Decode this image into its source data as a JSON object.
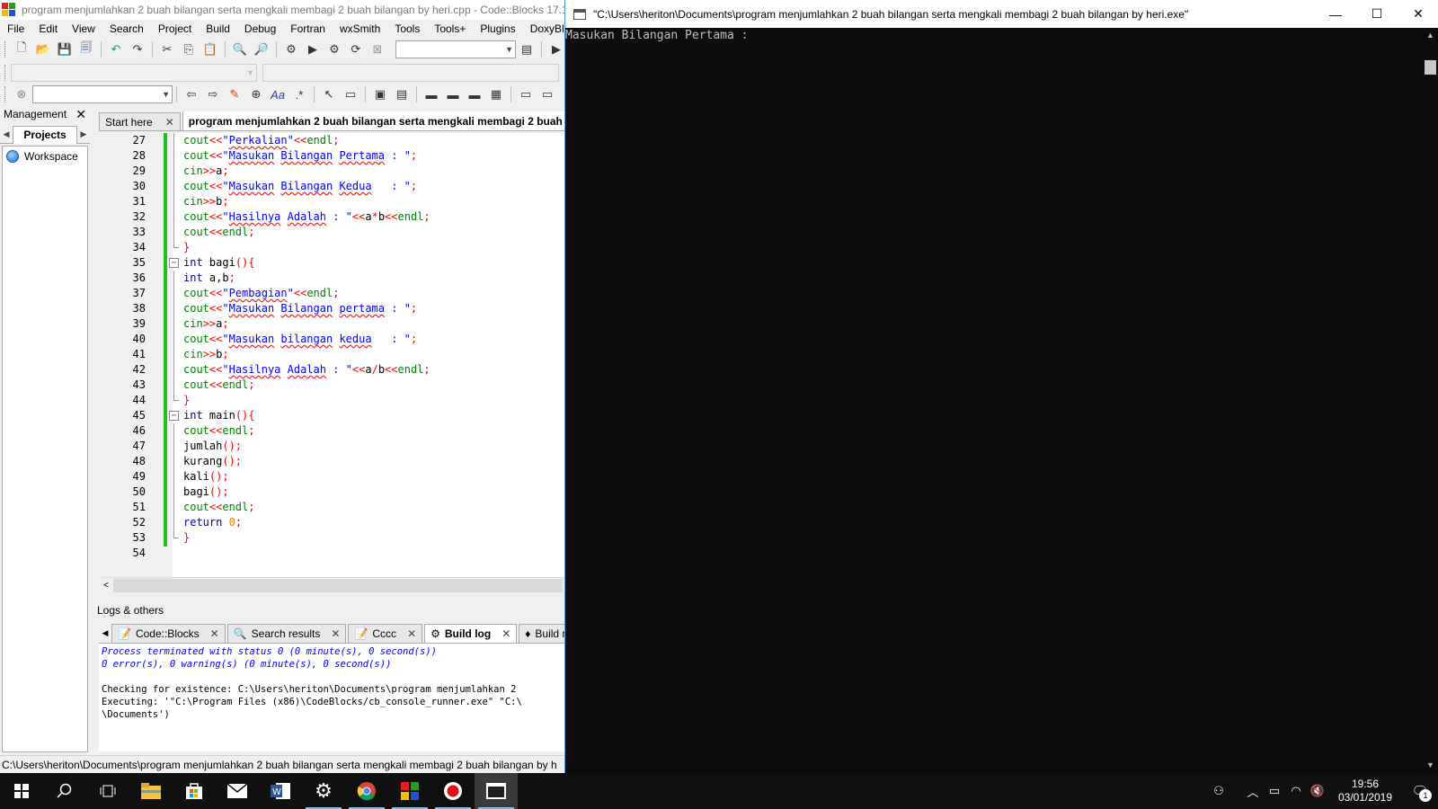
{
  "ide": {
    "title": "program menjumlahkan 2 buah bilangan serta mengkali membagi 2 buah bilangan by heri.cpp - Code::Blocks 17.1",
    "menu": [
      "File",
      "Edit",
      "View",
      "Search",
      "Project",
      "Build",
      "Debug",
      "Fortran",
      "wxSmith",
      "Tools",
      "Tools+",
      "Plugins",
      "DoxyBlocks"
    ],
    "management": {
      "title": "Management",
      "tab": "Projects",
      "workspace": "Workspace"
    },
    "editor_tabs": [
      {
        "label": "Start here",
        "active": false
      },
      {
        "label": "program menjumlahkan 2 buah bilangan serta mengkali membagi 2 buah",
        "active": true
      }
    ],
    "code_lines": [
      {
        "n": "27",
        "segs": [
          [
            "io",
            "cout"
          ],
          [
            "op",
            "<<"
          ],
          [
            "str",
            "\""
          ],
          [
            "str sq",
            "Perkalian"
          ],
          [
            "str",
            "\""
          ],
          [
            "op",
            "<<"
          ],
          [
            "io",
            "endl"
          ],
          [
            "op",
            ";"
          ]
        ]
      },
      {
        "n": "28",
        "segs": [
          [
            "io",
            "cout"
          ],
          [
            "op",
            "<<"
          ],
          [
            "str",
            "\""
          ],
          [
            "str sq",
            "Masukan"
          ],
          [
            "str",
            " "
          ],
          [
            "str sq",
            "Bilangan"
          ],
          [
            "str",
            " "
          ],
          [
            "str sq",
            "Pertama"
          ],
          [
            "str",
            " : \""
          ],
          [
            "op",
            ";"
          ]
        ]
      },
      {
        "n": "29",
        "segs": [
          [
            "io",
            "cin"
          ],
          [
            "op",
            ">>"
          ],
          [
            "id",
            "a"
          ],
          [
            "op",
            ";"
          ]
        ]
      },
      {
        "n": "30",
        "segs": [
          [
            "io",
            "cout"
          ],
          [
            "op",
            "<<"
          ],
          [
            "str",
            "\""
          ],
          [
            "str sq",
            "Masukan"
          ],
          [
            "str",
            " "
          ],
          [
            "str sq",
            "Bilangan"
          ],
          [
            "str",
            " "
          ],
          [
            "str sq",
            "Kedua"
          ],
          [
            "str",
            "   : \""
          ],
          [
            "op",
            ";"
          ]
        ]
      },
      {
        "n": "31",
        "segs": [
          [
            "io",
            "cin"
          ],
          [
            "op",
            ">>"
          ],
          [
            "id",
            "b"
          ],
          [
            "op",
            ";"
          ]
        ]
      },
      {
        "n": "32",
        "segs": [
          [
            "io",
            "cout"
          ],
          [
            "op",
            "<<"
          ],
          [
            "str",
            "\""
          ],
          [
            "str sq",
            "Hasilnya"
          ],
          [
            "str",
            " "
          ],
          [
            "str sq",
            "Adalah"
          ],
          [
            "str",
            " : \""
          ],
          [
            "op",
            "<<"
          ],
          [
            "id",
            "a"
          ],
          [
            "op",
            "*"
          ],
          [
            "id",
            "b"
          ],
          [
            "op",
            "<<"
          ],
          [
            "io",
            "endl"
          ],
          [
            "op",
            ";"
          ]
        ]
      },
      {
        "n": "33",
        "segs": [
          [
            "io",
            "cout"
          ],
          [
            "op",
            "<<"
          ],
          [
            "io",
            "endl"
          ],
          [
            "op",
            ";"
          ]
        ]
      },
      {
        "n": "34",
        "segs": [
          [
            "op",
            "}"
          ]
        ]
      },
      {
        "n": "35",
        "segs": [
          [
            "kw",
            "int"
          ],
          [
            "id",
            " bagi"
          ],
          [
            "op",
            "(){"
          ]
        ]
      },
      {
        "n": "36",
        "segs": [
          [
            "kw",
            "int"
          ],
          [
            "id",
            " a,b"
          ],
          [
            "op",
            ";"
          ]
        ]
      },
      {
        "n": "37",
        "segs": [
          [
            "io",
            "cout"
          ],
          [
            "op",
            "<<"
          ],
          [
            "str",
            "\""
          ],
          [
            "str sq",
            "Pembagian"
          ],
          [
            "str",
            "\""
          ],
          [
            "op",
            "<<"
          ],
          [
            "io",
            "endl"
          ],
          [
            "op",
            ";"
          ]
        ]
      },
      {
        "n": "38",
        "segs": [
          [
            "io",
            "cout"
          ],
          [
            "op",
            "<<"
          ],
          [
            "str",
            "\""
          ],
          [
            "str sq",
            "Masukan"
          ],
          [
            "str",
            " "
          ],
          [
            "str sq",
            "Bilangan"
          ],
          [
            "str",
            " "
          ],
          [
            "str sq",
            "pertama"
          ],
          [
            "str",
            " : \""
          ],
          [
            "op",
            ";"
          ]
        ]
      },
      {
        "n": "39",
        "segs": [
          [
            "io",
            "cin"
          ],
          [
            "op",
            ">>"
          ],
          [
            "id",
            "a"
          ],
          [
            "op",
            ";"
          ]
        ]
      },
      {
        "n": "40",
        "segs": [
          [
            "io",
            "cout"
          ],
          [
            "op",
            "<<"
          ],
          [
            "str",
            "\""
          ],
          [
            "str sq",
            "Masukan"
          ],
          [
            "str",
            " "
          ],
          [
            "str sq",
            "bilangan"
          ],
          [
            "str",
            " "
          ],
          [
            "str sq",
            "kedua"
          ],
          [
            "str",
            "   : \""
          ],
          [
            "op",
            ";"
          ]
        ]
      },
      {
        "n": "41",
        "segs": [
          [
            "io",
            "cin"
          ],
          [
            "op",
            ">>"
          ],
          [
            "id",
            "b"
          ],
          [
            "op",
            ";"
          ]
        ]
      },
      {
        "n": "42",
        "segs": [
          [
            "io",
            "cout"
          ],
          [
            "op",
            "<<"
          ],
          [
            "str",
            "\""
          ],
          [
            "str sq",
            "Hasilnya"
          ],
          [
            "str",
            " "
          ],
          [
            "str sq",
            "Adalah"
          ],
          [
            "str",
            " : \""
          ],
          [
            "op",
            "<<"
          ],
          [
            "id",
            "a"
          ],
          [
            "op",
            "/"
          ],
          [
            "id",
            "b"
          ],
          [
            "op",
            "<<"
          ],
          [
            "io",
            "endl"
          ],
          [
            "op",
            ";"
          ]
        ]
      },
      {
        "n": "43",
        "segs": [
          [
            "io",
            "cout"
          ],
          [
            "op",
            "<<"
          ],
          [
            "io",
            "endl"
          ],
          [
            "op",
            ";"
          ]
        ]
      },
      {
        "n": "44",
        "segs": [
          [
            "op",
            "}"
          ]
        ]
      },
      {
        "n": "45",
        "segs": [
          [
            "kw",
            "int"
          ],
          [
            "id",
            " main"
          ],
          [
            "op",
            "(){"
          ]
        ]
      },
      {
        "n": "46",
        "segs": [
          [
            "io",
            "cout"
          ],
          [
            "op",
            "<<"
          ],
          [
            "io",
            "endl"
          ],
          [
            "op",
            ";"
          ]
        ]
      },
      {
        "n": "47",
        "segs": [
          [
            "id",
            "jumlah"
          ],
          [
            "op",
            "();"
          ]
        ]
      },
      {
        "n": "48",
        "segs": [
          [
            "id",
            "kurang"
          ],
          [
            "op",
            "();"
          ]
        ]
      },
      {
        "n": "49",
        "segs": [
          [
            "id",
            "kali"
          ],
          [
            "op",
            "();"
          ]
        ]
      },
      {
        "n": "50",
        "segs": [
          [
            "id",
            "bagi"
          ],
          [
            "op",
            "();"
          ]
        ]
      },
      {
        "n": "51",
        "segs": [
          [
            "io",
            "cout"
          ],
          [
            "op",
            "<<"
          ],
          [
            "io",
            "endl"
          ],
          [
            "op",
            ";"
          ]
        ]
      },
      {
        "n": "52",
        "segs": [
          [
            "kw",
            "return"
          ],
          [
            "id",
            " "
          ],
          [
            "num",
            "0"
          ],
          [
            "op",
            ";"
          ]
        ]
      },
      {
        "n": "53",
        "segs": [
          [
            "op",
            "}"
          ]
        ]
      },
      {
        "n": "54",
        "segs": []
      }
    ],
    "logs": {
      "title": "Logs & others",
      "tabs": [
        {
          "label": "Code::Blocks",
          "icon": "📝",
          "active": false,
          "close": true
        },
        {
          "label": "Search results",
          "icon": "🔍",
          "active": false,
          "close": true
        },
        {
          "label": "Cccc",
          "icon": "📝",
          "active": false,
          "close": true
        },
        {
          "label": "Build log",
          "icon": "⚙",
          "active": true,
          "close": true
        },
        {
          "label": "Build me",
          "icon": "♦",
          "active": false,
          "close": false
        }
      ],
      "lines_blue": [
        "Process terminated with status 0 (0 minute(s), 0 second(s))",
        "0 error(s), 0 warning(s) (0 minute(s), 0 second(s))"
      ],
      "lines_plain": [
        "Checking for existence: C:\\Users\\heriton\\Documents\\program menjumlahkan 2",
        "Executing: '\"C:\\Program Files (x86)\\CodeBlocks/cb_console_runner.exe\" \"C:\\",
        "\\Documents')"
      ]
    },
    "status": "C:\\Users\\heriton\\Documents\\program menjumlahkan 2 buah bilangan serta mengkali membagi 2 buah bilangan by h"
  },
  "console": {
    "title": "\"C:\\Users\\heriton\\Documents\\program menjumlahkan 2 buah bilangan serta mengkali membagi 2 buah bilangan by heri.exe\"",
    "output": "Masukan Bilangan Pertama : "
  },
  "taskbar": {
    "time": "19:56",
    "date": "03/01/2019",
    "notification_count": "1"
  }
}
